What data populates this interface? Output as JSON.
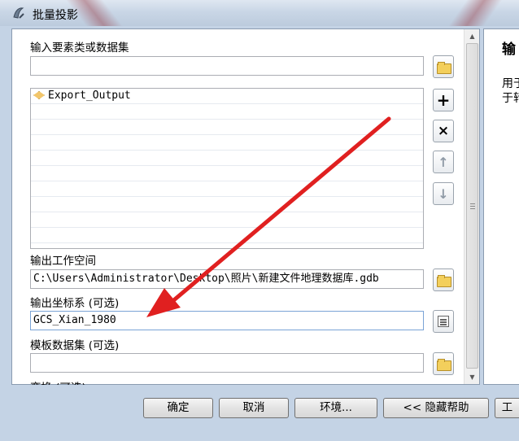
{
  "window": {
    "title": "批量投影"
  },
  "form": {
    "input_label": "输入要素类或数据集",
    "input_value": "",
    "list_items": [
      "Export_Output"
    ],
    "workspace_label": "输出工作空间",
    "workspace_value": "C:\\Users\\Administrator\\Desktop\\照片\\新建文件地理数据库.gdb",
    "coord_label": "输出坐标系 (可选)",
    "coord_value": "GCS_Xian_1980",
    "template_label": "模板数据集 (可选)",
    "template_value": "",
    "transform_label": "变换 (可选)"
  },
  "side_buttons": {
    "add": "+",
    "remove": "×",
    "up": "↑",
    "down": "↓"
  },
  "help": {
    "title": "输",
    "text_line1": "用于",
    "text_line2": "于转"
  },
  "buttons": {
    "ok": "确定",
    "cancel": "取消",
    "environments": "环境...",
    "hide_help": "<< 隐藏帮助",
    "tool_help": "工"
  },
  "annotation": {
    "arrow_color": "#e02020"
  }
}
